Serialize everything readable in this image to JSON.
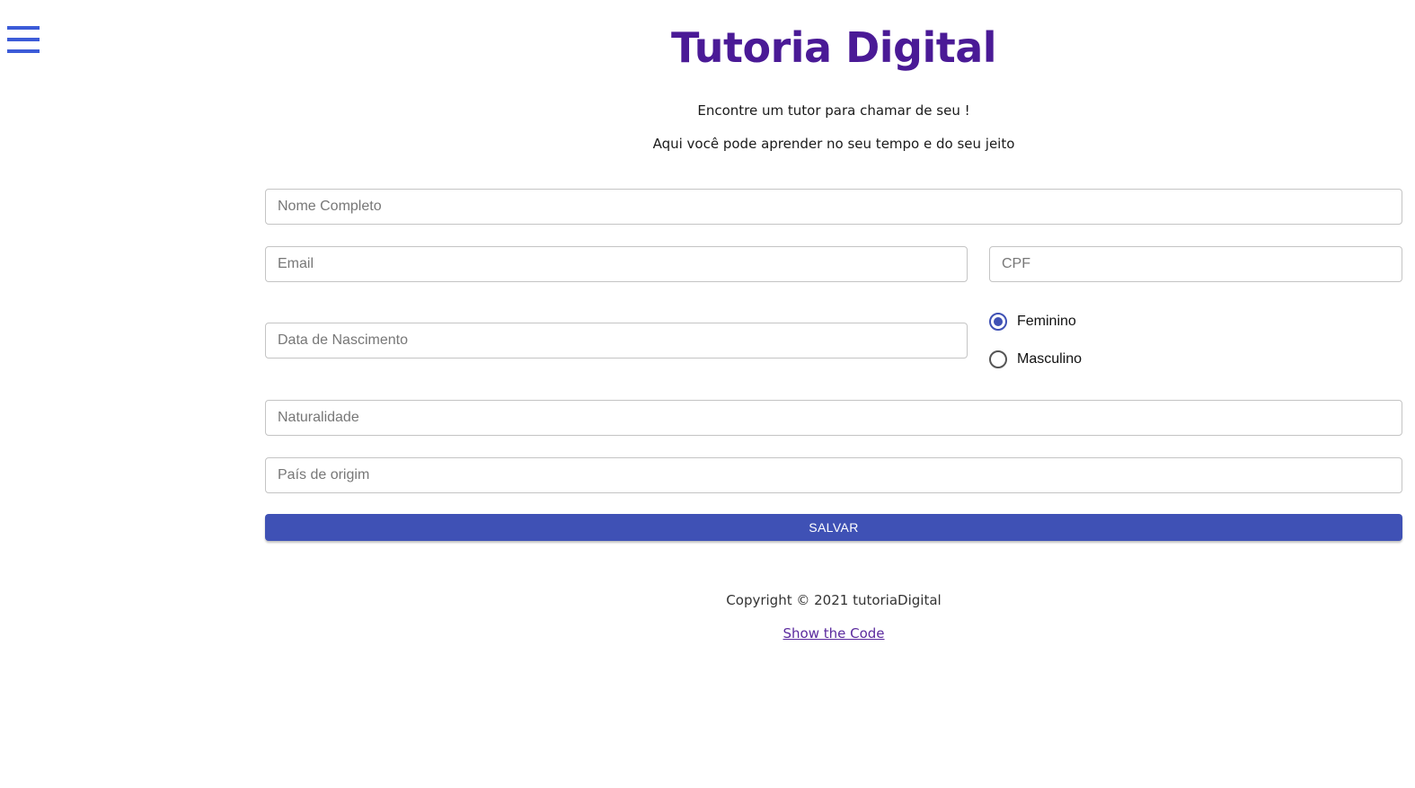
{
  "header": {
    "menu_icon": "hamburger-menu-icon",
    "title": "Tutoria Digital",
    "subtitle_1": "Encontre um tutor para chamar de seu !",
    "subtitle_2": "Aqui você pode aprender no seu tempo e do seu jeito"
  },
  "form": {
    "nome_placeholder": "Nome Completo",
    "email_placeholder": "Email",
    "cpf_placeholder": "CPF",
    "data_placeholder": "Data de Nascimento",
    "gender": {
      "options": [
        "Feminino",
        "Masculino"
      ],
      "selected": "Feminino"
    },
    "naturalidade_placeholder": "Naturalidade",
    "pais_placeholder": "País de origim",
    "save_label": "SALVAR"
  },
  "footer": {
    "copyright": "Copyright © 2021 tutoriaDigital",
    "code_link": "Show the Code"
  },
  "colors": {
    "title": "#4a1a96",
    "accent": "#3f51b5",
    "menu_icon": "#3c5bd8",
    "link": "#5b2a9e"
  }
}
